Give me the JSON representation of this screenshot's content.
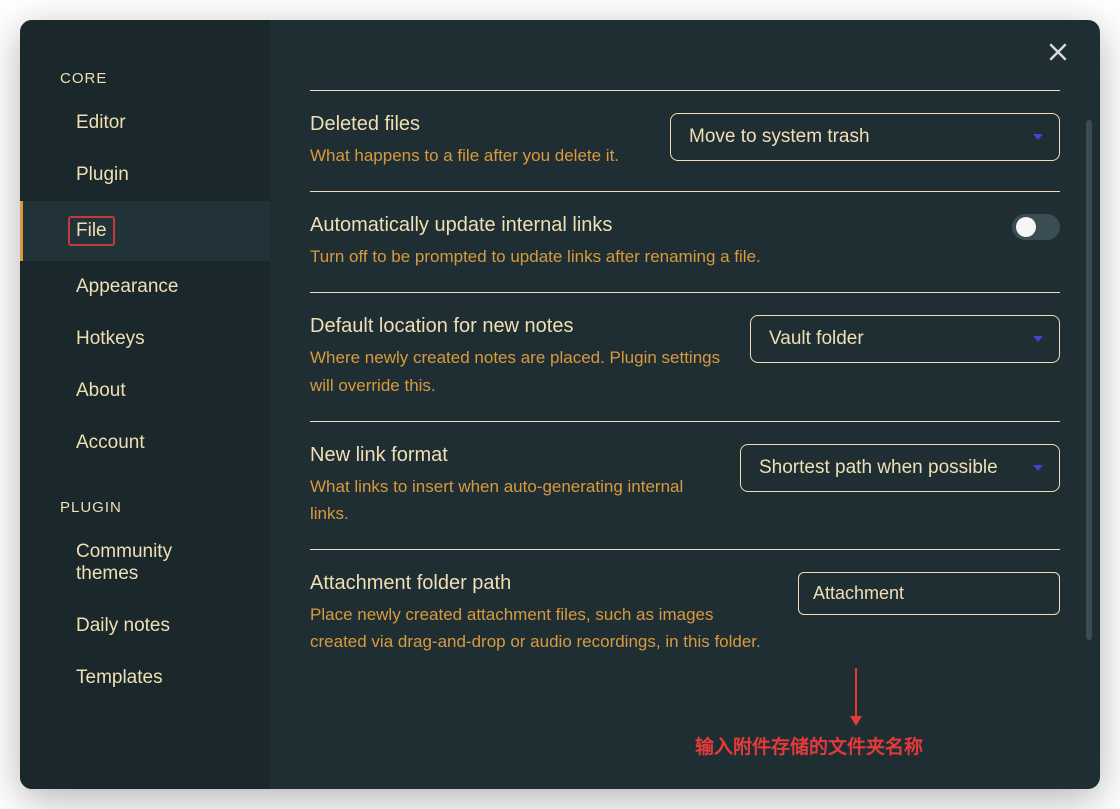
{
  "sidebar": {
    "sections": [
      {
        "label": "CORE",
        "items": [
          {
            "label": "Editor",
            "active": false
          },
          {
            "label": "Plugin",
            "active": false
          },
          {
            "label": "File",
            "active": true,
            "highlighted": true
          },
          {
            "label": "Appearance",
            "active": false
          },
          {
            "label": "Hotkeys",
            "active": false
          },
          {
            "label": "About",
            "active": false
          },
          {
            "label": "Account",
            "active": false
          }
        ]
      },
      {
        "label": "PLUGIN",
        "items": [
          {
            "label": "Community themes",
            "active": false
          },
          {
            "label": "Daily notes",
            "active": false
          },
          {
            "label": "Templates",
            "active": false
          }
        ]
      }
    ]
  },
  "settings": {
    "deleted_files": {
      "title": "Deleted files",
      "desc": "What happens to a file after you delete it.",
      "value": "Move to system trash"
    },
    "auto_update_links": {
      "title": "Automatically update internal links",
      "desc": "Turn off to be prompted to update links after renaming a file.",
      "enabled": false
    },
    "default_location": {
      "title": "Default location for new notes",
      "desc": "Where newly created notes are placed. Plugin settings will override this.",
      "value": "Vault folder"
    },
    "new_link_format": {
      "title": "New link format",
      "desc": "What links to insert when auto-generating internal links.",
      "value": "Shortest path when possible"
    },
    "attachment_path": {
      "title": "Attachment folder path",
      "desc": "Place newly created attachment files, such as images created via drag-and-drop or audio recordings, in this folder.",
      "value": "Attachment"
    }
  },
  "annotation": {
    "text": "输入附件存储的文件夹名称"
  }
}
